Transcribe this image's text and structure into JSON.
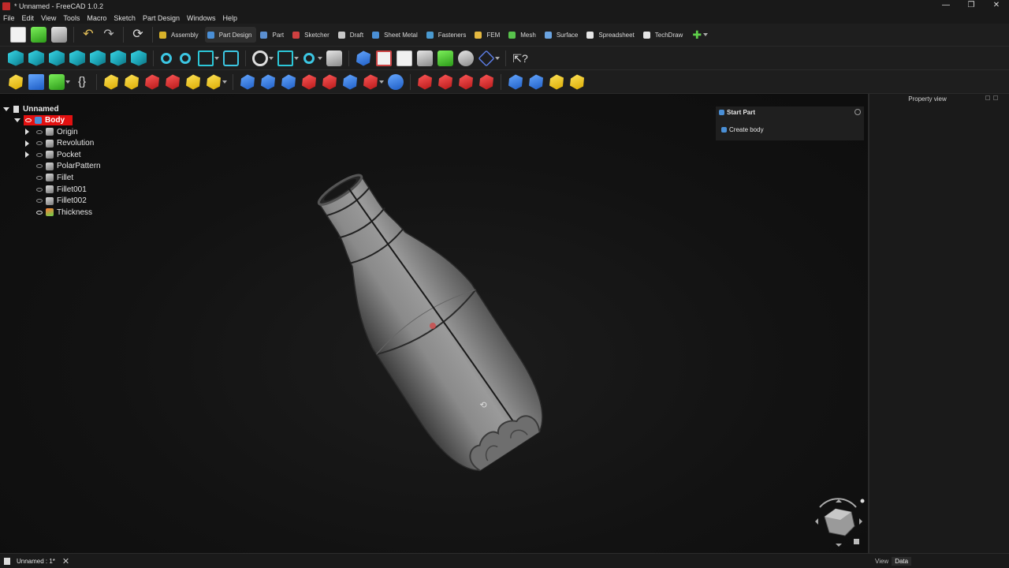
{
  "window": {
    "title": "* Unnamed - FreeCAD 1.0.2",
    "controls": [
      "—",
      "❐",
      "✕"
    ]
  },
  "menu": [
    "File",
    "Edit",
    "View",
    "Tools",
    "Macro",
    "Sketch",
    "Part Design",
    "Windows",
    "Help"
  ],
  "workbenches": [
    {
      "label": "Assembly",
      "color": "#d9b32a",
      "active": false
    },
    {
      "label": "Part Design",
      "color": "#4a8fd6",
      "active": true
    },
    {
      "label": "Part",
      "color": "#5b8fd0",
      "active": false
    },
    {
      "label": "Sketcher",
      "color": "#d04040",
      "active": false
    },
    {
      "label": "Draft",
      "color": "#c8c8c8",
      "active": false
    },
    {
      "label": "Sheet Metal",
      "color": "#4a8fd6",
      "active": false
    },
    {
      "label": "Fasteners",
      "color": "#4a9ad0",
      "active": false
    },
    {
      "label": "FEM",
      "color": "#e4b840",
      "active": false
    },
    {
      "label": "Mesh",
      "color": "#58c24c",
      "active": false
    },
    {
      "label": "Surface",
      "color": "#6aa3e0",
      "active": false
    },
    {
      "label": "Spreadsheet",
      "color": "#e6e6e6",
      "active": false
    },
    {
      "label": "TechDraw",
      "color": "#e6e6e6",
      "active": false
    }
  ],
  "tree": {
    "root": "Unnamed",
    "body": "Body",
    "features": [
      {
        "label": "Origin",
        "expandable": true,
        "visible": false
      },
      {
        "label": "Revolution",
        "expandable": true,
        "visible": false
      },
      {
        "label": "Pocket",
        "expandable": true,
        "visible": false
      },
      {
        "label": "PolarPattern",
        "expandable": false,
        "visible": false
      },
      {
        "label": "Fillet",
        "expandable": false,
        "visible": false
      },
      {
        "label": "Fillet001",
        "expandable": false,
        "visible": false
      },
      {
        "label": "Fillet002",
        "expandable": false,
        "visible": false
      },
      {
        "label": "Thickness",
        "expandable": false,
        "visible": true
      }
    ]
  },
  "taskpanel": {
    "title": "Start Part",
    "action": "Create body"
  },
  "propview": {
    "title": "Property view",
    "tabs": [
      "View",
      "Data"
    ],
    "active_tab": "Data"
  },
  "statusbar": {
    "document_tab": "Unnamed : 1*"
  }
}
